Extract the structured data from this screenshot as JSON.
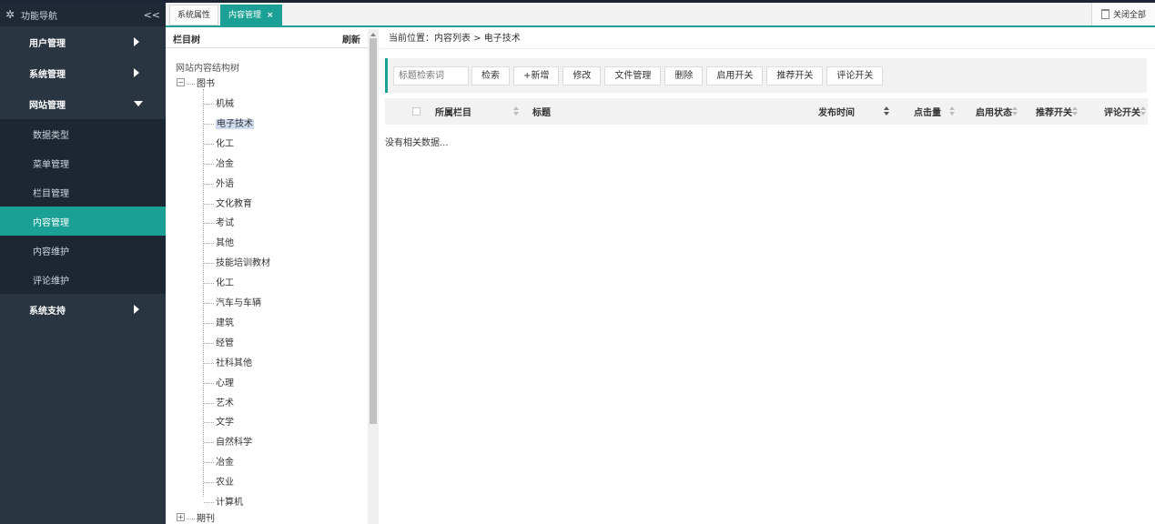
{
  "nav": {
    "title": "功能导航",
    "collapse_glyph": "<<",
    "items": [
      {
        "label": "用户管理",
        "state": "collapsed"
      },
      {
        "label": "系统管理",
        "state": "collapsed"
      },
      {
        "label": "网站管理",
        "state": "expanded"
      }
    ],
    "sub_items": [
      {
        "label": "数据类型"
      },
      {
        "label": "菜单管理"
      },
      {
        "label": "栏目管理"
      },
      {
        "label": "内容管理",
        "active": true
      },
      {
        "label": "内容维护"
      },
      {
        "label": "评论维护"
      }
    ],
    "support": {
      "label": "系统支持"
    }
  },
  "tabs": [
    {
      "label": "系统属性",
      "active": false
    },
    {
      "label": "内容管理",
      "active": true,
      "close_glyph": "×"
    }
  ],
  "close_all_label": "关闭全部",
  "tree": {
    "header": "栏目树",
    "refresh": "刷新",
    "root": "网站内容结构树",
    "book": {
      "label": "图书",
      "toggle": "−"
    },
    "book_children": [
      "机械",
      "电子技术",
      "化工",
      "冶金",
      "外语",
      "文化教育",
      "考试",
      "其他",
      "技能培训教材",
      "化工",
      "汽车与车辆",
      "建筑",
      "经管",
      "社科其他",
      "心理",
      "艺术",
      "文学",
      "自然科学",
      "冶金",
      "农业",
      "计算机"
    ],
    "selected_index": 1,
    "journal": {
      "label": "期刊",
      "toggle": "+"
    }
  },
  "breadcrumb": "当前位置：内容列表 > 电子技术",
  "toolbar": {
    "search_placeholder": "标题检索词",
    "buttons": [
      "检索",
      "+新增",
      "修改",
      "文件管理",
      "删除",
      "启用开关",
      "推荐开关",
      "评论开关"
    ]
  },
  "table": {
    "columns": [
      "所属栏目",
      "标题",
      "发布时间",
      "点击量",
      "启用状态",
      "推荐开关",
      "评论开关"
    ],
    "empty_text": "没有相关数据..."
  },
  "colors": {
    "accent": "#1aa094",
    "nav_bg": "#2a3542",
    "nav_sub_bg": "#1d2733"
  }
}
